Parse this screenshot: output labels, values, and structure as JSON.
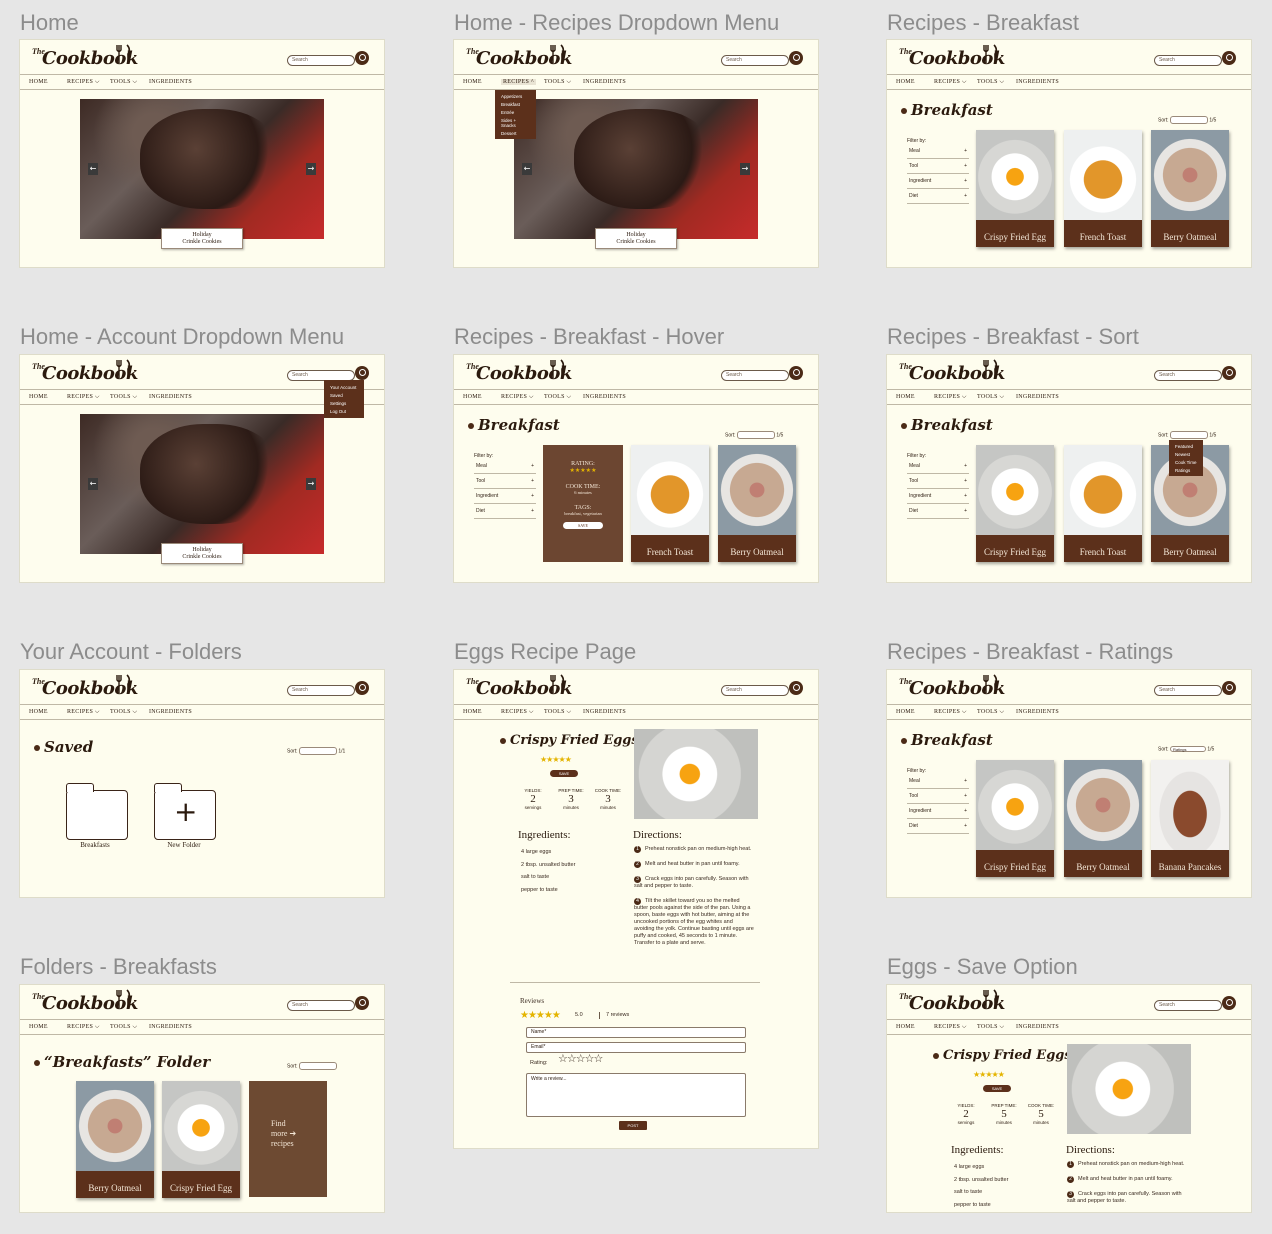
{
  "labels": [
    "Home",
    "Home - Recipes Dropdown Menu",
    "Recipes - Breakfast",
    "Home - Account Dropdown Menu",
    "Recipes - Breakfast - Hover",
    "Recipes - Breakfast - Sort",
    "Your Account - Folders",
    "Eggs Recipe Page",
    "Recipes - Breakfast - Ratings",
    "Folders - Breakfasts",
    "Eggs - Save Option"
  ],
  "header": {
    "the": "The",
    "logo": "Cookbook",
    "search_placeholder": "Search"
  },
  "nav": {
    "home": "HOME",
    "recipes": "RECIPES ⌵",
    "recipes_open": "RECIPES ^",
    "tools": "TOOLS ⌵",
    "ingredients": "INGREDIENTS"
  },
  "hero": {
    "caption_line1": "Holiday",
    "caption_line2": "Crinkle Cookies",
    "prev": "←",
    "next": "→"
  },
  "recipes_menu": [
    "Appetizers",
    "Breakfast",
    "Entrée",
    "Sides + Snacks",
    "Dessert"
  ],
  "account_menu": [
    "Your Account",
    "Saved",
    "Settings",
    "Log Out"
  ],
  "breakfast": {
    "title": "Breakfast",
    "sort_label": "Sort:",
    "pager": "1/5",
    "filter_label": "Filter by:",
    "filters": [
      "Meal",
      "Tool",
      "Ingredient",
      "Diet"
    ]
  },
  "cards": {
    "egg": "Crispy Fried Egg",
    "toast": "French Toast",
    "oat": "Berry Oatmeal",
    "pancakes": "Banana Pancakes"
  },
  "hover": {
    "rating_label": "RATING:",
    "stars": "★★★★★",
    "cook_label": "COOK TIME:",
    "cook_value": "6 minutes",
    "tags_label": "TAGS:",
    "tags_value": "breakfast, vegetarian",
    "save": "SAVE"
  },
  "sort_options": [
    "Featured",
    "Newest",
    "Cook Time",
    "Ratings"
  ],
  "sort_selected": "Ratings",
  "saved": {
    "title": "Saved",
    "sort_label": "Sort:",
    "pager": "1/1",
    "folder1": "Breakfasts",
    "folder2": "New Folder"
  },
  "folder_view": {
    "title": "“Breakfasts” Folder",
    "find_more_1": "Find",
    "find_more_2": "more ➔",
    "find_more_3": "recipes"
  },
  "recipe": {
    "title": "Crispy Fried Eggs",
    "stars": "★★★★★",
    "save": "SAVE",
    "yields_label": "YIELDS:",
    "yields_value": "2",
    "yields_unit": "servings",
    "prep_label": "PREP TIME:",
    "prep_value": "3",
    "prep_value_alt": "5",
    "prep_unit": "minutes",
    "cook_label": "COOK TIME:",
    "cook_value": "3",
    "cook_value_alt": "5",
    "cook_unit": "minutes",
    "ingredients_title": "Ingredients:",
    "ingredients": [
      "4 large eggs",
      "2 tbsp. unsalted butter",
      "salt to taste",
      "pepper to taste"
    ],
    "directions_title": "Directions:",
    "directions": [
      "Preheat nonstick pan on medium-high heat.",
      "Melt and heat butter in pan until foamy.",
      "Crack eggs into pan carefully. Season with salt and pepper to taste.",
      "Tilt the skillet toward you so the melted butter pools against the side of the pan. Using a spoon, baste eggs with hot butter, aiming at the uncooked portions of the egg whites and avoiding the yolk. Continue basting until eggs are puffy and cooked, 45 seconds to 1 minute. Transfer to a plate and serve."
    ],
    "reviews_title": "Reviews",
    "reviews_score": "5.0",
    "reviews_count": "7 reviews",
    "name_ph": "Name*",
    "email_ph": "Email*",
    "rating_label": "Rating:",
    "rating_empty": "☆☆☆☆☆",
    "review_ph": "Write a review...",
    "post": "POST"
  },
  "colors": {
    "brand": "#4b2a16",
    "card": "#5c301b",
    "bg": "#fefdee",
    "star": "#e4b400"
  }
}
